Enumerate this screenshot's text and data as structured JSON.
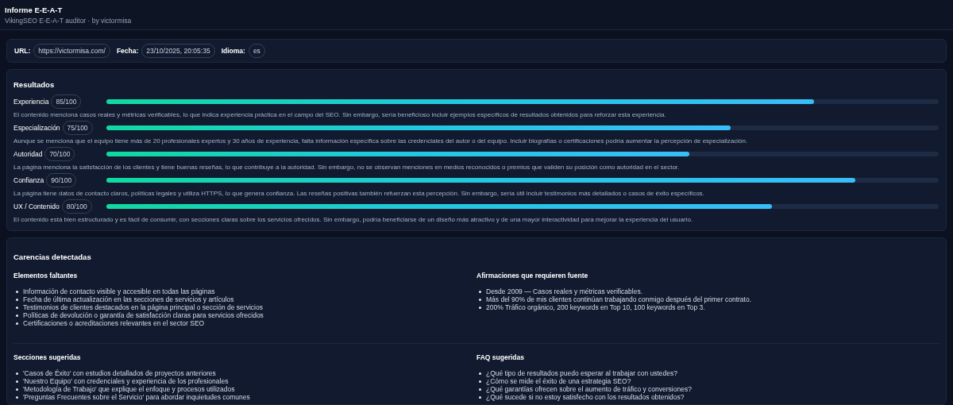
{
  "header": {
    "title": "Informe E-E-A-T",
    "subtitle": "VikingSEO E-E-A-T auditor · by victormisa"
  },
  "meta": [
    {
      "label": "URL:",
      "value": "https://victormisa.com/"
    },
    {
      "label": "Fecha:",
      "value": "23/10/2025, 20:05:35"
    },
    {
      "label": "Idioma:",
      "value": "es"
    }
  ],
  "results": {
    "title": "Resultados",
    "items": [
      {
        "name": "Experiencia",
        "score": "85/100",
        "level": 0.85,
        "description": "El contenido menciona casos reales y métricas verificables, lo que indica experiencia práctica en el campo del SEO. Sin embargo, sería beneficioso incluir ejemplos específicos de resultados obtenidos para reforzar esta experiencia."
      },
      {
        "name": "Especialización",
        "score": "75/100",
        "level": 0.75,
        "description": "Aunque se menciona que el equipo tiene más de 20 profesionales expertos y 30 años de experiencia, falta información específica sobre las credenciales del autor o del equipo. Incluir biografías o certificaciones podría aumentar la percepción de especialización."
      },
      {
        "name": "Autoridad",
        "score": "70/100",
        "level": 0.7,
        "description": "La página menciona la satisfacción de los clientes y tiene buenas reseñas, lo que contribuye a la autoridad. Sin embargo, no se observan menciones en medios reconocidos o premios que validen su posición como autoridad en el sector."
      },
      {
        "name": "Confianza",
        "score": "90/100",
        "level": 0.9,
        "description": "La página tiene datos de contacto claros, políticas legales y utiliza HTTPS, lo que genera confianza. Las reseñas positivas también refuerzan esta percepción. Sin embargo, sería útil incluir testimonios más detallados o casos de éxito específicos."
      },
      {
        "name": "UX / Contenido",
        "score": "80/100",
        "level": 0.8,
        "description": "El contenido está bien estructurado y es fácil de consumir, con secciones claras sobre los servicios ofrecidos. Sin embargo, podría beneficiarse de un diseño más atractivo y de una mayor interactividad para mejorar la experiencia del usuario."
      }
    ]
  },
  "gaps": {
    "title": "Carencias detectadas",
    "groups": [
      {
        "title": "Elementos faltantes",
        "items": [
          "Información de contacto visible y accesible en todas las páginas",
          "Fecha de última actualización en las secciones de servicios y artículos",
          "Testimonios de clientes destacados en la página principal o sección de servicios",
          "Políticas de devolución o garantía de satisfacción claras para servicios ofrecidos",
          "Certificaciones o acreditaciones relevantes en el sector SEO"
        ]
      },
      {
        "title": "Afirmaciones que requieren fuente",
        "items": [
          "Desde 2009 — Casos reales y métricas verificables.",
          "Más del 90% de mis clientes continúan trabajando conmigo después del primer contrato.",
          "200% Tráfico orgánico, 200 keywords en Top 10, 100 keywords en Top 3."
        ]
      },
      {
        "title": "Secciones sugeridas",
        "items": [
          "'Casos de Éxito' con estudios detallados de proyectos anteriores",
          "'Nuestro Equipo' con credenciales y experiencia de los profesionales",
          "'Metodología de Trabajo' que explique el enfoque y procesos utilizados",
          "'Preguntas Frecuentes sobre el Servicio' para abordar inquietudes comunes"
        ]
      },
      {
        "title": "FAQ sugeridas",
        "items": [
          "¿Qué tipo de resultados puedo esperar al trabajar con ustedes?",
          "¿Cómo se mide el éxito de una estrategia SEO?",
          "¿Qué garantías ofrecen sobre el aumento de tráfico y conversiones?",
          "¿Qué sucede si no estoy satisfecho con los resultados obtenidos?"
        ]
      }
    ]
  }
}
